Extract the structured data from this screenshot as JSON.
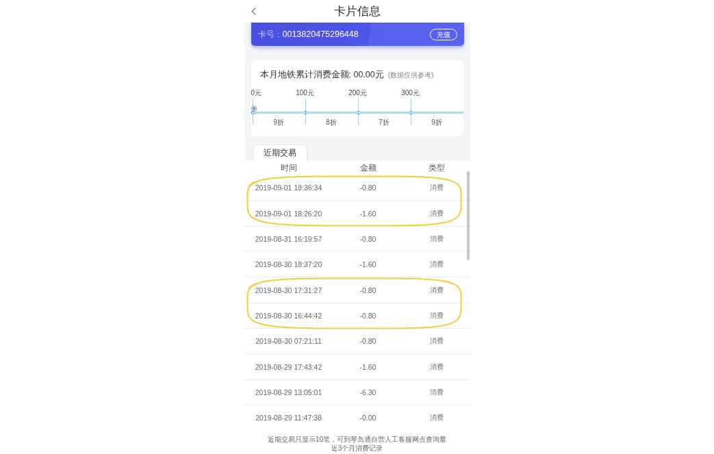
{
  "header": {
    "title": "卡片信息"
  },
  "card": {
    "number_label": "卡号：",
    "number": "0013820475296448",
    "button": "充值"
  },
  "spending": {
    "title": "本月地铁累计消费金额: 00.00元",
    "note": "(数据仅供参考)",
    "level": 0,
    "milestones": [
      "0元",
      "100元",
      "200元",
      "300元"
    ],
    "discounts": [
      "9折",
      "8折",
      "7折",
      "9折"
    ]
  },
  "tabs": [
    {
      "label": "近期交易",
      "selected": true
    }
  ],
  "transactions": {
    "columns": [
      "时间",
      "金额",
      "类型"
    ],
    "rows": [
      {
        "time": "2019-09-01 18:36:34",
        "amount": "-0.80",
        "type": "消费",
        "circled": true
      },
      {
        "time": "2019-09-01 18:26:20",
        "amount": "-1.60",
        "type": "消费",
        "circled": true
      },
      {
        "time": "2019-08-31 16:19:57",
        "amount": "-0.80",
        "type": "消费",
        "circled": false
      },
      {
        "time": "2019-08-30 18:37:20",
        "amount": "-1.60",
        "type": "消费",
        "circled": false
      },
      {
        "time": "2019-08-30 17:31:27",
        "amount": "-0.80",
        "type": "消费",
        "circled": true
      },
      {
        "time": "2019-08-30 16:44:42",
        "amount": "-0.80",
        "type": "消费",
        "circled": true
      },
      {
        "time": "2019-08-30 07:21:11",
        "amount": "-0.80",
        "type": "消费",
        "circled": false
      },
      {
        "time": "2019-08-29 17:43:42",
        "amount": "-1.60",
        "type": "消费",
        "circled": false
      },
      {
        "time": "2019-08-29 13:05:01",
        "amount": "-6.30",
        "type": "消费",
        "circled": false
      },
      {
        "time": "2019-08-29 11:47:38",
        "amount": "-0.00",
        "type": "消费",
        "circled": false
      }
    ]
  },
  "footer_note": "近期交易只显示10笔，可到琴岛通自营人工客服网点查询最近3个月消费记录"
}
